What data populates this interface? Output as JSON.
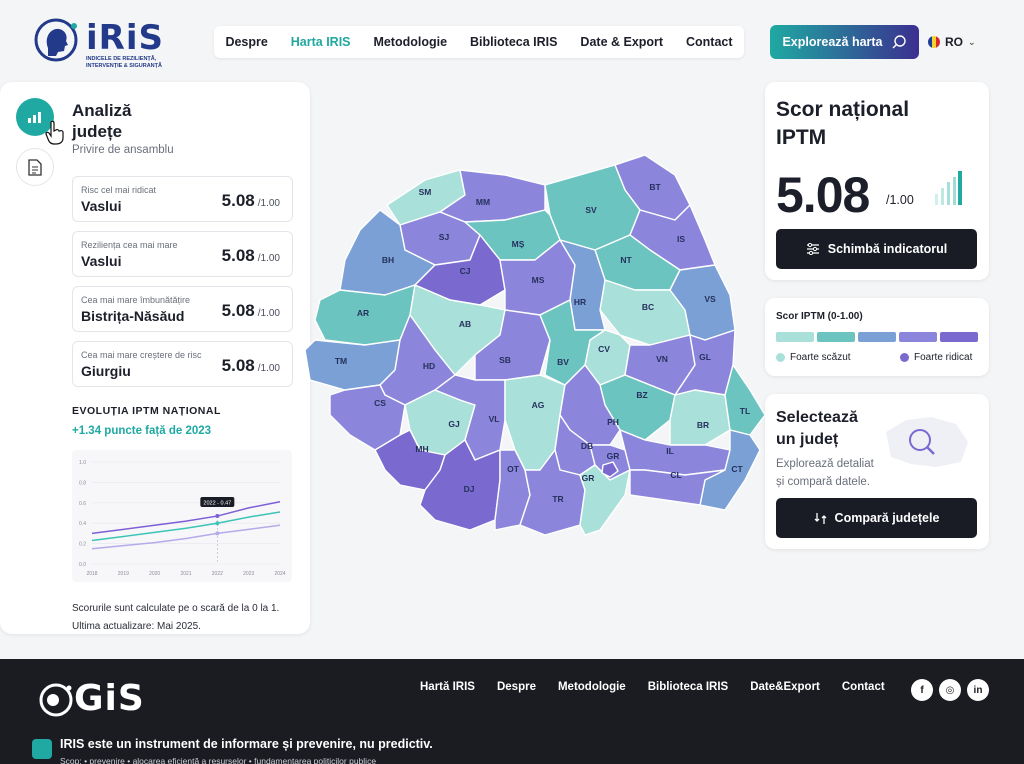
{
  "brand": {
    "name": "iRiS",
    "subtitle": "INDICELE DE REZILIENȚĂ, INTERVENȚIE & SIGURANȚĂ"
  },
  "nav": {
    "items": [
      "Despre",
      "Harta IRIS",
      "Metodologie",
      "Biblioteca IRIS",
      "Date & Export",
      "Contact"
    ],
    "active": "Harta IRIS"
  },
  "explore_button": "Explorează harta",
  "language": "RO",
  "left_panel": {
    "title": "Analiză județe",
    "subtitle": "Privire de ansamblu",
    "cards": [
      {
        "label": "Risc cel mai ridicat",
        "name": "Vaslui",
        "value": "5.08",
        "max": "/1.00"
      },
      {
        "label": "Reziliența cea mai mare",
        "name": "Vaslui",
        "value": "5.08",
        "max": "/1.00"
      },
      {
        "label": "Cea mai mare îmbunătățire",
        "name": "Bistrița-Năsăud",
        "value": "5.08",
        "max": "/1.00"
      },
      {
        "label": "Cea mai mare creștere de risc",
        "name": "Giurgiu",
        "value": "5.08",
        "max": "/1.00"
      }
    ],
    "evolution_title": "EVOLUȚIA IPTM NAȚIONAL",
    "evolution_delta": "+1.34 puncte față de 2023",
    "footnote": [
      "Scorurile sunt calculate pe o scară de la 0 la 1.",
      "Ultima actualizare: Mai 2025."
    ]
  },
  "chart_data": {
    "type": "line",
    "x": [
      "2018",
      "2019",
      "2020",
      "2021",
      "2022",
      "2023",
      "2024"
    ],
    "ylim": [
      0,
      1
    ],
    "yticks": [
      "1.0",
      "0.8",
      "0.6",
      "0.4",
      "0.2",
      "0.0"
    ],
    "series": [
      {
        "color": "#7c5fd6",
        "values": [
          0.3,
          0.34,
          0.38,
          0.42,
          0.47,
          0.55,
          0.61
        ]
      },
      {
        "color": "#3cc4b6",
        "values": [
          0.23,
          0.27,
          0.31,
          0.35,
          0.4,
          0.46,
          0.51
        ]
      },
      {
        "color": "#b7a9ea",
        "values": [
          0.15,
          0.18,
          0.21,
          0.25,
          0.3,
          0.34,
          0.38
        ]
      }
    ],
    "tooltip": "2022 - 0.47"
  },
  "national_score": {
    "title": "Scor național IPTM",
    "value": "5.08",
    "max": "/1.00",
    "button": "Schimbă indicatorul"
  },
  "legend": {
    "title": "Scor IPTM (0-1.00)",
    "colors": [
      "#a9e0da",
      "#6cc4c0",
      "#7aa0d6",
      "#8b86dc",
      "#7a6acf"
    ],
    "low": "Foarte scăzut",
    "high": "Foarte ridicat",
    "low_color": "#a9e0da",
    "high_color": "#7a6acf"
  },
  "select_county": {
    "title": "Selectează un județ",
    "description": "Explorează detaliat și compară datele.",
    "button": "Compară județele"
  },
  "map": {
    "counties": [
      "SM",
      "MM",
      "BT",
      "SV",
      "IS",
      "SJ",
      "MȘ",
      "BH",
      "CJ",
      "NT",
      "BC",
      "VS",
      "MS",
      "HR",
      "AR",
      "AB",
      "TM",
      "SB",
      "CV",
      "VN",
      "GL",
      "HD",
      "BV",
      "CS",
      "BZ",
      "GJ",
      "VL",
      "AG",
      "PH",
      "BR",
      "TL",
      "MH",
      "DB",
      "GR",
      "IL",
      "CT",
      "DJ",
      "OT",
      "TR",
      "CL"
    ]
  },
  "footer": {
    "logo": "GiS",
    "nav": [
      "Hartă IRIS",
      "Despre",
      "Metodologie",
      "Biblioteca IRIS",
      "Date&Export",
      "Contact"
    ],
    "social": [
      "f",
      "◎",
      "in"
    ],
    "tagline": "IRIS este un instrument de informare și prevenire, nu predictiv.",
    "scope": "Scop:  •  prevenire  •  alocarea eficientă a resurselor  •  fundamentarea politicilor publice"
  }
}
